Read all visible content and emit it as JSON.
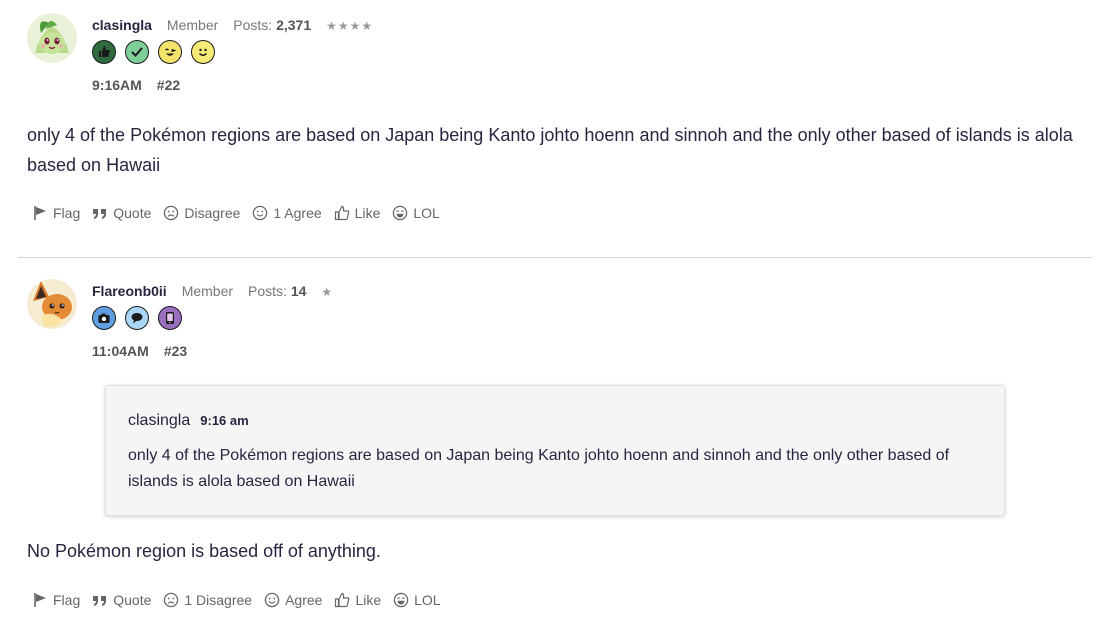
{
  "posts": [
    {
      "username": "clasingla",
      "role": "Member",
      "posts_label": "Posts:",
      "posts_count": "2,371",
      "stars": "★★★★",
      "badge_icons": [
        "thumbs-up-badge-icon",
        "checkmark-badge-icon",
        "wink-face-badge-icon",
        "smile-face-badge-icon"
      ],
      "time": "9:16AM",
      "number": "#22",
      "body": "only 4 of the Pokémon regions are based on Japan being Kanto johto hoenn and sinnoh and the only other based of islands is alola based on Hawaii",
      "actions": {
        "flag": "Flag",
        "quote": "Quote",
        "disagree": "Disagree",
        "agree": "1 Agree",
        "like": "Like",
        "lol": "LOL"
      }
    },
    {
      "username": "Flareonb0ii",
      "role": "Member",
      "posts_label": "Posts:",
      "posts_count": "14",
      "stars": "★",
      "badge_icons": [
        "camera-badge-icon",
        "speech-bubble-badge-icon",
        "phone-badge-icon"
      ],
      "time": "11:04AM",
      "number": "#23",
      "quote": {
        "author": "clasingla",
        "time": "9:16 am",
        "text": "only 4 of the Pokémon regions are based on Japan being Kanto johto hoenn and sinnoh and the only other based of islands is alola based on Hawaii"
      },
      "body": "No Pokémon region is based off of anything.",
      "actions": {
        "flag": "Flag",
        "quote": "Quote",
        "disagree": "1 Disagree",
        "agree": "Agree",
        "like": "Like",
        "lol": "LOL"
      }
    }
  ],
  "colors": {
    "text": "#2a2440",
    "muted": "#777777",
    "quote_bg": "#f5f5f5"
  }
}
